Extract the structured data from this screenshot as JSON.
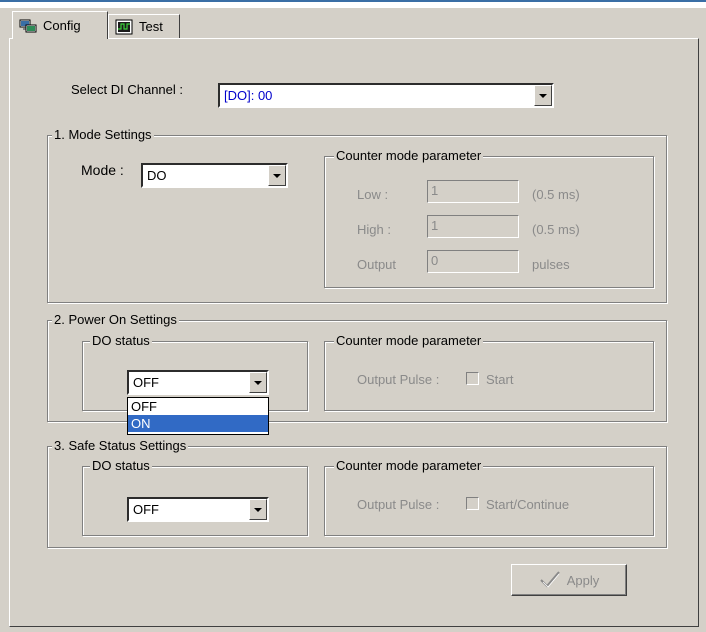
{
  "tabs": [
    {
      "label": "Config",
      "icon": "network-config-icon"
    },
    {
      "label": "Test",
      "icon": "oscilloscope-icon"
    }
  ],
  "channel": {
    "label": "Select DI Channel :",
    "value": "[DO]: 00"
  },
  "mode_settings": {
    "title": "1. Mode Settings",
    "mode_label": "Mode :",
    "mode_value": "DO",
    "counter": {
      "title": "Counter mode parameter",
      "low_label": "Low :",
      "low_value": "1",
      "low_unit": "(0.5 ms)",
      "high_label": "High :",
      "high_value": "1",
      "high_unit": "(0.5 ms)",
      "output_label": "Output",
      "output_value": "0",
      "output_unit": "pulses"
    }
  },
  "power_on": {
    "title": "2. Power On Settings",
    "do_status_title": "DO status",
    "do_value": "OFF",
    "options": [
      "OFF",
      "ON"
    ],
    "highlighted_option": "ON",
    "counter": {
      "title": "Counter mode parameter",
      "output_pulse_label": "Output Pulse :",
      "checkbox_label": "Start"
    }
  },
  "safe_status": {
    "title": "3. Safe Status Settings",
    "do_status_title": "DO status",
    "do_value": "OFF",
    "counter": {
      "title": "Counter mode parameter",
      "output_pulse_label": "Output Pulse :",
      "checkbox_label": "Start/Continue"
    }
  },
  "apply": {
    "label": "Apply",
    "icon": "checkmark-icon"
  },
  "colors": {
    "face": "#d4d0c8",
    "selection": "#316ac5",
    "channel_text": "#0000cc",
    "disabled_text": "#8a8a8a"
  }
}
